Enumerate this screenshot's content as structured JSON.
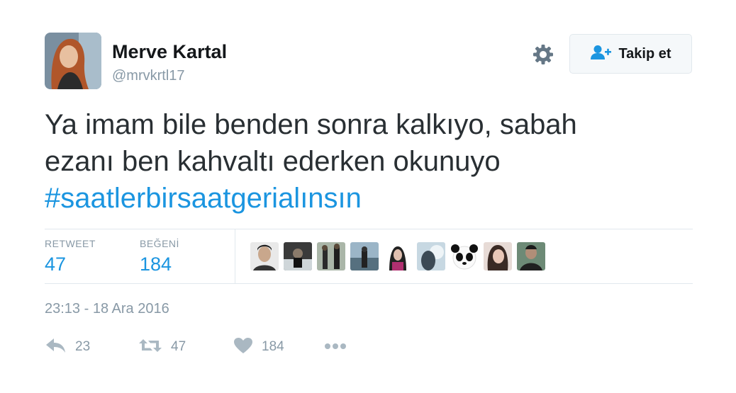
{
  "user": {
    "display_name": "Merve Kartal",
    "handle": "@mrvkrtl17"
  },
  "follow_button": {
    "label": "Takip et"
  },
  "tweet": {
    "text_line1": "Ya imam bile benden sonra kalkıyo, sabah",
    "text_line2": "ezanı ben kahvaltı ederken okunuyo",
    "hashtag": "#saatlerbirsaatgerialınsın"
  },
  "stats": {
    "retweet_label": "RETWEET",
    "retweet_count": "47",
    "like_label": "BEĞENİ",
    "like_count": "184"
  },
  "timestamp": "23:13 - 18 Ara 2016",
  "actions": {
    "reply_count": "23",
    "retweet_count": "47",
    "like_count": "184"
  },
  "colors": {
    "accent": "#1b95e0",
    "muted": "#8899a6",
    "text": "#292f33"
  },
  "icons": {
    "gear": "gear-icon",
    "follow": "add-person-icon",
    "reply": "reply-icon",
    "retweet": "retweet-icon",
    "like": "heart-icon",
    "more": "more-icon"
  }
}
